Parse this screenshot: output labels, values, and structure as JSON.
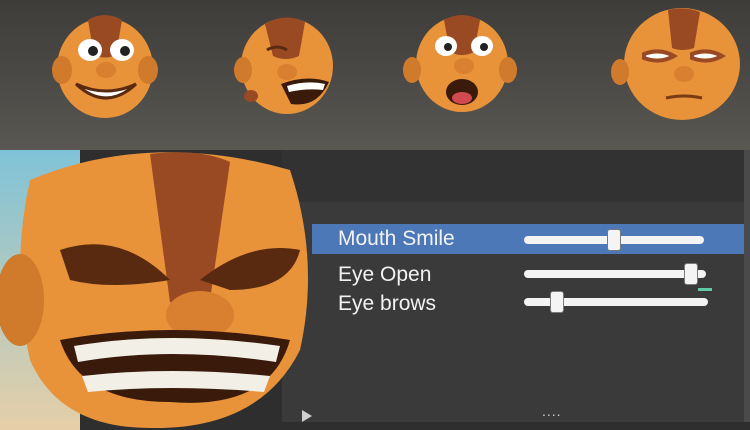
{
  "blendshapes": {
    "items": [
      {
        "label": "Mouth Smile",
        "value": 0.5,
        "selected": true
      },
      {
        "label": "Eye Open",
        "value": 0.92,
        "selected": false
      },
      {
        "label": "Eye brows",
        "value": 0.18,
        "selected": false
      }
    ]
  },
  "timeline": {
    "dots": "...."
  },
  "colors": {
    "selection": "#4d78b8",
    "skin": "#e8923a",
    "stripe": "#9a4a22",
    "panel": "#3a3a3a"
  }
}
